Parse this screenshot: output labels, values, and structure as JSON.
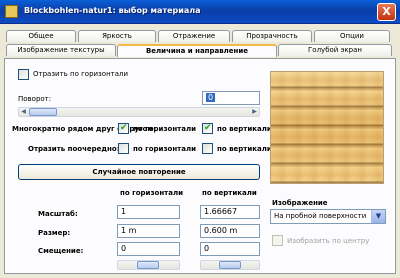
{
  "window": {
    "title": "Blockbohlen-natur1: выбор материала",
    "close_label": "X"
  },
  "tabs_row1": [
    "Общее",
    "Яркость",
    "Отражение",
    "Прозрачность",
    "Опции"
  ],
  "tabs_row2": [
    "Изображение текстуры",
    "Величина и направление",
    "Голубой экран"
  ],
  "active_tab": "Величина и направление",
  "mirror_horizontal": {
    "label": "Отразить по горизонтали",
    "checked": false
  },
  "rotation": {
    "label": "Поворот:",
    "value": "0",
    "slider_position": 0
  },
  "repeat_side": {
    "label": "Многократно рядом друг с другом:",
    "horizontal_label": "по горизонтали",
    "horizontal_checked": true,
    "vertical_label": "по вертикали",
    "vertical_checked": true
  },
  "mirror_alternate": {
    "label": "Отразить поочередно:",
    "horizontal_label": "по горизонтали",
    "horizontal_checked": false,
    "vertical_label": "по вертикали",
    "vertical_checked": false
  },
  "random_repeat_button": "Случайное повторение",
  "grid": {
    "col_horizontal": "по горизонтали",
    "col_vertical": "по вертикали",
    "scale_label": "Масштаб:",
    "scale_h": "1",
    "scale_v": "1.66667",
    "size_label": "Размер:",
    "size_h": "1 m",
    "size_v": "0.600 m",
    "offset_label": "Смещение:",
    "offset_h": "0",
    "offset_v": "0"
  },
  "image_section": {
    "label": "Изображение",
    "select_value": "На пробной поверхности",
    "center_label": "Изобразить по центру",
    "center_checked": false
  },
  "colors": {
    "title_bar": "#0a4ec4",
    "tab_highlight": "#f1b94a",
    "check_mark": "#21a121"
  },
  "icons": {
    "app": "texture-icon",
    "close": "close-icon",
    "dropdown": "chevron-down-icon"
  }
}
